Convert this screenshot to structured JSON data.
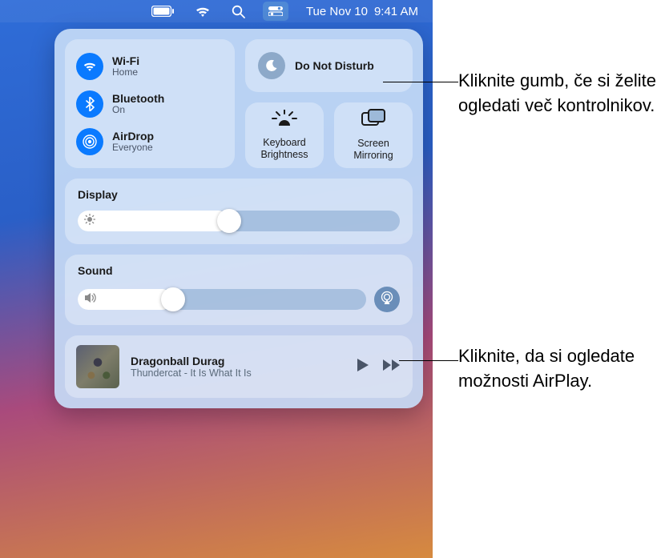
{
  "menubar": {
    "datetime_day": "Tue Nov 10",
    "datetime_time": "9:41 AM"
  },
  "connectivity": {
    "wifi": {
      "title": "Wi-Fi",
      "status": "Home"
    },
    "bluetooth": {
      "title": "Bluetooth",
      "status": "On"
    },
    "airdrop": {
      "title": "AirDrop",
      "status": "Everyone"
    }
  },
  "dnd": {
    "title": "Do Not Disturb"
  },
  "keyboard_brightness": {
    "label": "Keyboard Brightness"
  },
  "screen_mirroring": {
    "label": "Screen Mirroring"
  },
  "display": {
    "title": "Display",
    "value_pct": 47
  },
  "sound": {
    "title": "Sound",
    "value_pct": 33
  },
  "media": {
    "track": "Dragonball Durag",
    "artist": "Thundercat - It Is What It Is"
  },
  "callouts": {
    "c1": "Kliknite gumb, če si želite ogledati več kontrolnikov.",
    "c2": "Kliknite, da si ogledate možnosti AirPlay."
  }
}
